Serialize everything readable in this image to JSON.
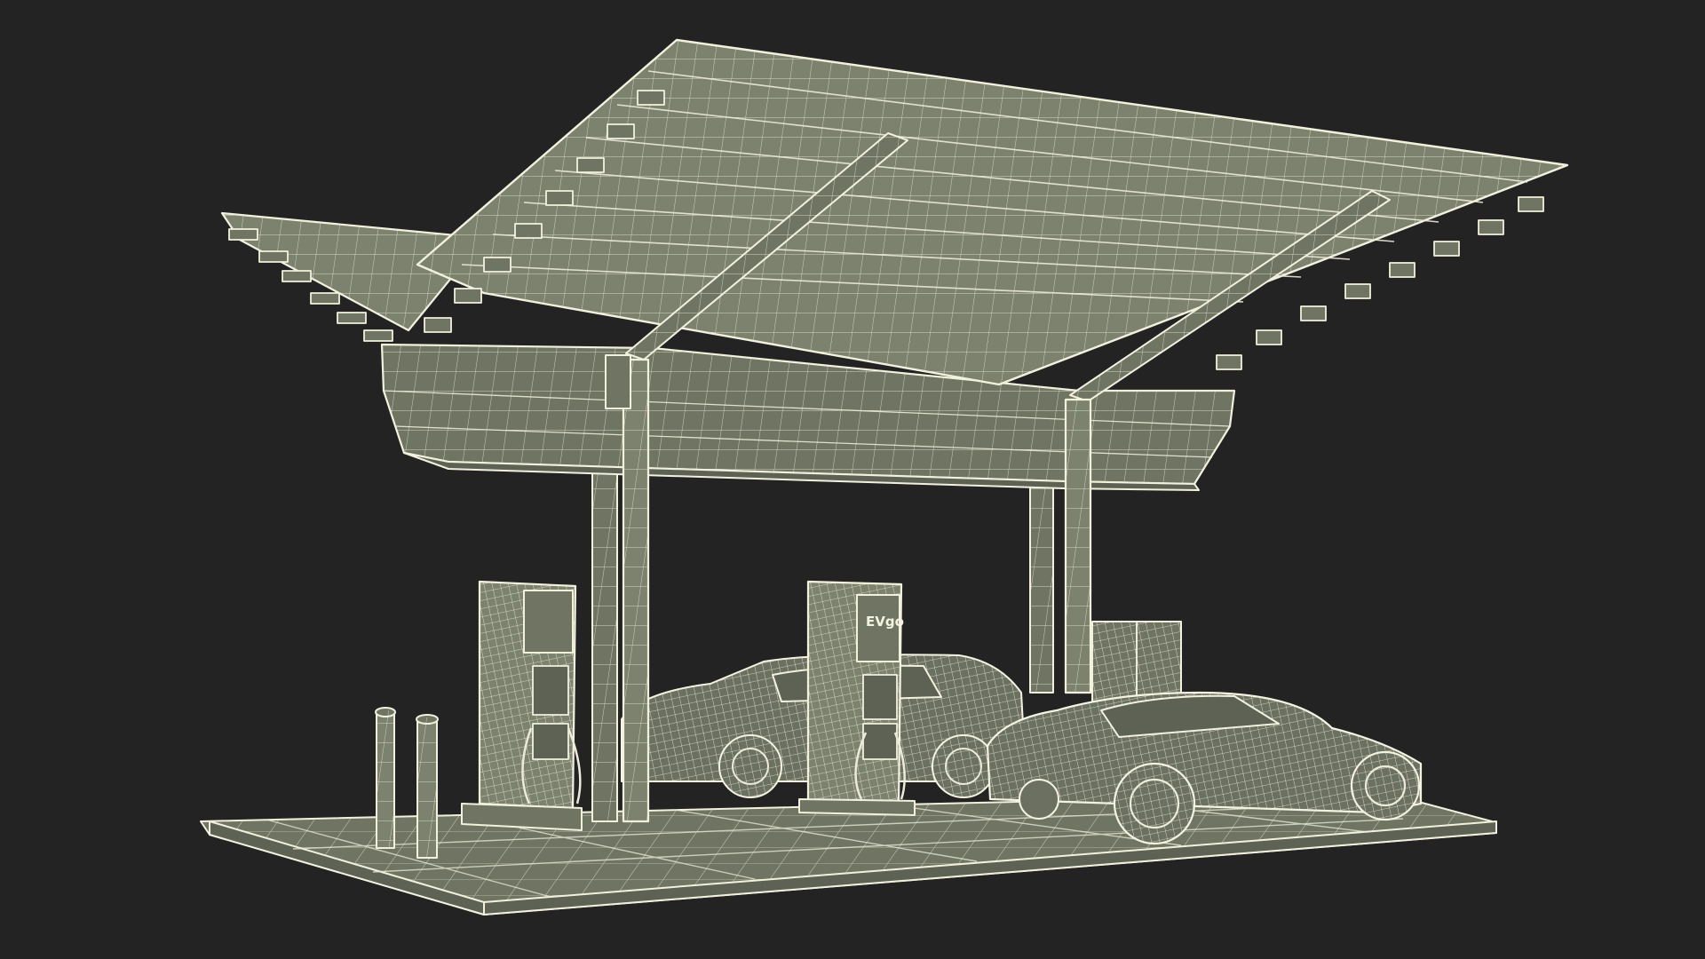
{
  "scene": {
    "subject": "ev-charging-station-wireframe",
    "background_color": "#232323",
    "wire_color": "#ecebd9",
    "surface_color": "#707563",
    "charger_brand_label": "EVgo"
  }
}
